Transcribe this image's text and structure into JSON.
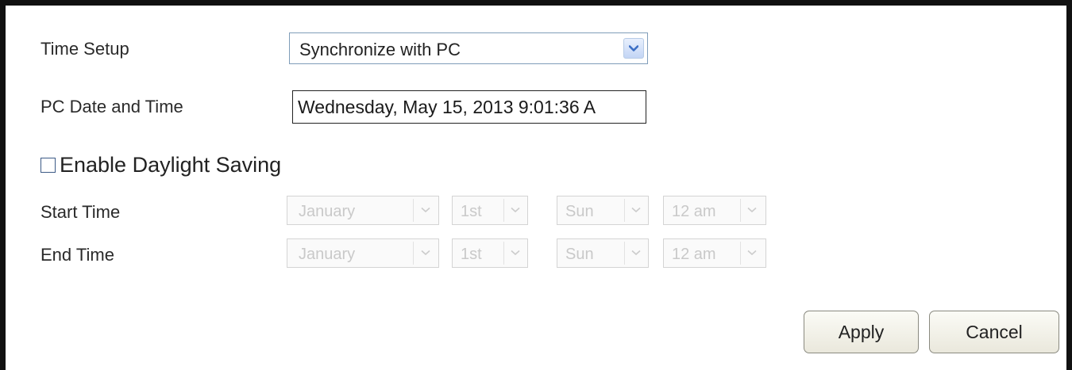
{
  "time_setup": {
    "label": "Time Setup",
    "selected": "Synchronize with PC"
  },
  "pc_datetime": {
    "label": "PC Date and Time",
    "value": "Wednesday, May 15, 2013 9:01:36 A"
  },
  "daylight_saving": {
    "label": "Enable Daylight Saving",
    "checked": false
  },
  "start_time": {
    "label": "Start Time",
    "month": "January",
    "day": "1st",
    "weekday": "Sun",
    "hour": "12 am"
  },
  "end_time": {
    "label": "End Time",
    "month": "January",
    "day": "1st",
    "weekday": "Sun",
    "hour": "12 am"
  },
  "buttons": {
    "apply": "Apply",
    "cancel": "Cancel"
  },
  "colors": {
    "frame": "#111111",
    "select_arrow": "#3c6fc4",
    "disabled_text": "#c9c9c9"
  },
  "icons": {
    "dropdown": "chevron-down-icon"
  }
}
